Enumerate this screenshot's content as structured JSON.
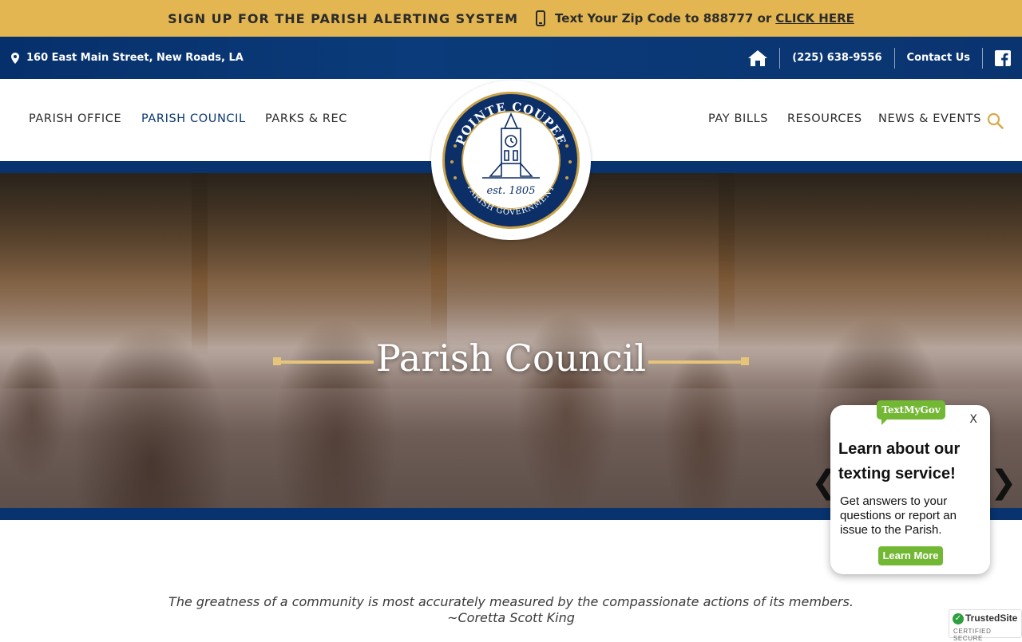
{
  "alert_bar": {
    "title": "SIGN UP FOR THE PARISH ALERTING SYSTEM",
    "text": "Text Your Zip Code to 888777 or",
    "link": "CLICK HERE",
    "icon": "phone-icon"
  },
  "info_bar": {
    "address": "160 East Main Street, New Roads, LA",
    "phone": "(225) 638-9556",
    "contact": "Contact Us",
    "icons": [
      "map-pin-icon",
      "home-icon",
      "facebook-icon"
    ]
  },
  "nav": {
    "left": [
      "PARISH OFFICE",
      "PARISH COUNCIL",
      "PARKS & REC"
    ],
    "right": [
      "PAY BILLS",
      "RESOURCES",
      "NEWS & EVENTS"
    ],
    "active": "PARISH COUNCIL"
  },
  "logo": {
    "top_text": "POINTE COUPEE",
    "bottom_text": "PARISH GOVERNMENT",
    "est": "est. 1805"
  },
  "hero": {
    "title": "Parish Council",
    "prev_arrow": "❮",
    "next_arrow": "❯"
  },
  "quote": {
    "text": "The greatness of a community is most accurately measured by the compassionate actions of its members.",
    "author": "~Coretta Scott King"
  },
  "textmygov": {
    "badge": "TextMyGov",
    "close": "X",
    "heading": "Learn about our texting service!",
    "body": "Get answers to your questions or report an issue to the Parish.",
    "button": "Learn More"
  },
  "trusted_site": {
    "name": "TrustedSite",
    "sub": "CERTIFIED SECURE",
    "check": "✓"
  },
  "colors": {
    "gold": "#e3b651",
    "navy": "#08336f",
    "green": "#73b834"
  }
}
